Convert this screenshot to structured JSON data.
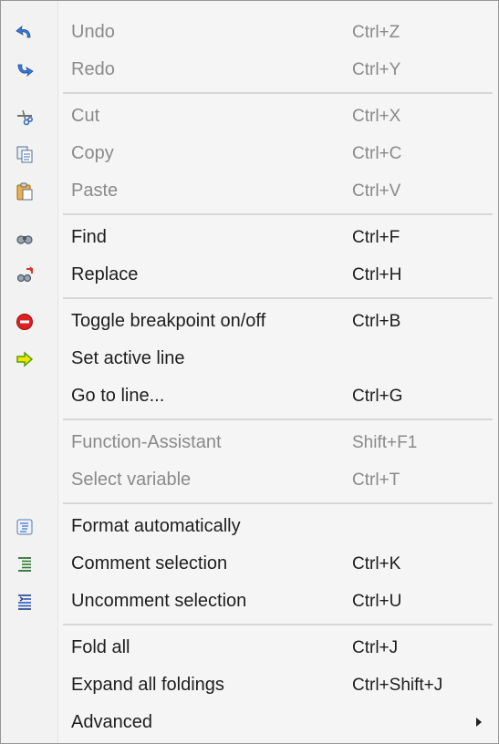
{
  "menu": {
    "items": [
      {
        "label": "Undo",
        "shortcut": "Ctrl+Z",
        "icon": "undo-icon",
        "disabled": true
      },
      {
        "label": "Redo",
        "shortcut": "Ctrl+Y",
        "icon": "redo-icon",
        "disabled": true
      },
      {
        "label": "Cut",
        "shortcut": "Ctrl+X",
        "icon": "scissors-icon",
        "disabled": true
      },
      {
        "label": "Copy",
        "shortcut": "Ctrl+C",
        "icon": "copy-icon",
        "disabled": true
      },
      {
        "label": "Paste",
        "shortcut": "Ctrl+V",
        "icon": "paste-icon",
        "disabled": true
      },
      {
        "label": "Find",
        "shortcut": "Ctrl+F",
        "icon": "binoculars-icon",
        "disabled": false
      },
      {
        "label": "Replace",
        "shortcut": "Ctrl+H",
        "icon": "replace-icon",
        "disabled": false
      },
      {
        "label": "Toggle breakpoint on/off",
        "shortcut": "Ctrl+B",
        "icon": "breakpoint-icon",
        "disabled": false
      },
      {
        "label": "Set active line",
        "shortcut": "",
        "icon": "arrow-right-icon",
        "disabled": false
      },
      {
        "label": "Go to line...",
        "shortcut": "Ctrl+G",
        "icon": "",
        "disabled": false
      },
      {
        "label": "Function-Assistant",
        "shortcut": "Shift+F1",
        "icon": "",
        "disabled": true
      },
      {
        "label": "Select variable",
        "shortcut": "Ctrl+T",
        "icon": "",
        "disabled": true
      },
      {
        "label": "Format automatically",
        "shortcut": "",
        "icon": "format-icon",
        "disabled": false
      },
      {
        "label": "Comment selection",
        "shortcut": "Ctrl+K",
        "icon": "comment-icon",
        "disabled": false
      },
      {
        "label": "Uncomment selection",
        "shortcut": "Ctrl+U",
        "icon": "uncomment-icon",
        "disabled": false
      },
      {
        "label": "Fold all",
        "shortcut": "Ctrl+J",
        "icon": "",
        "disabled": false
      },
      {
        "label": "Expand all foldings",
        "shortcut": "Ctrl+Shift+J",
        "icon": "",
        "disabled": false
      },
      {
        "label": "Advanced",
        "shortcut": "",
        "icon": "",
        "disabled": false,
        "submenu": true
      }
    ]
  },
  "colors": {
    "enabled_text": "#1e1e1e",
    "disabled_text": "#8a8a8a",
    "breakpoint_red": "#e02020",
    "arrow_yellow": "#f2e600",
    "undo_blue": "#2f6fd0"
  }
}
